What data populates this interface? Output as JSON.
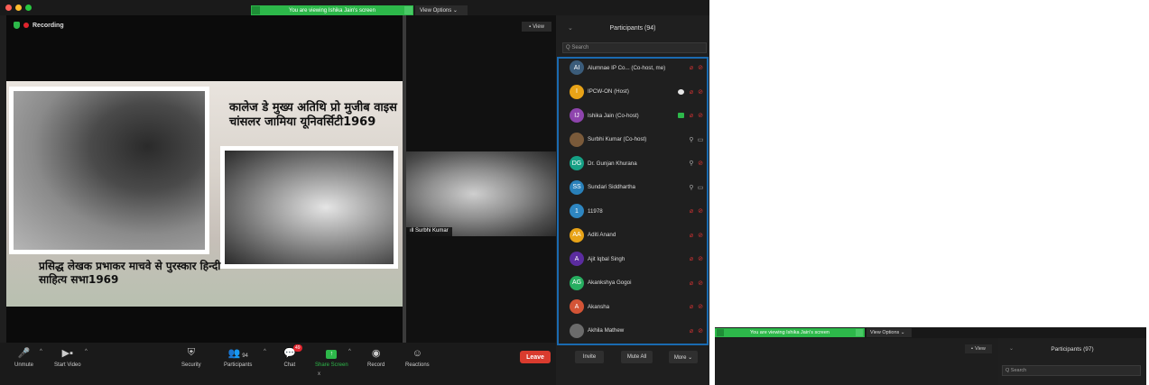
{
  "window": {
    "viewing_banner": "You are viewing Ishika Jain's screen",
    "view_options": "View Options ⌄",
    "recording": "Recording",
    "view_button": "View",
    "bottom_x": "x"
  },
  "slide": {
    "caption_top": "कालेज डे मुख्य अतिथि प्रो मुजीब वाइस चांसलर जामिया यूनिवर्सिटी1969",
    "caption_bottom": "प्रसिद्ध लेखक प्रभाकर माचवे से पुरस्कार हिन्दी साहित्य सभा1969"
  },
  "video": {
    "name": "Surbhi Kumar"
  },
  "participants_panel": {
    "title": "Participants (94)",
    "search_placeholder": "Q Search",
    "items": [
      {
        "initials": "AI",
        "name": "Alumnae IP Co... (Co-host, me)",
        "color": "#3b5c7a",
        "mic": "muted",
        "cam": "off"
      },
      {
        "initials": "I",
        "name": "IPCW-ON (Host)",
        "color": "#e8a317",
        "mic": "muted",
        "cam": "off",
        "extra": "white"
      },
      {
        "initials": "IJ",
        "name": "Ishika Jain (Co-host)",
        "color": "#8e44ad",
        "mic": "muted",
        "cam": "off",
        "extra": "green"
      },
      {
        "initials": "",
        "name": "Surbhi Kumar (Co-host)",
        "color": "#7a5a3a",
        "mic": "on",
        "cam": "on"
      },
      {
        "initials": "DG",
        "name": "Dr. Gunjan Khurana",
        "color": "#16a085",
        "mic": "on",
        "cam": "off"
      },
      {
        "initials": "SS",
        "name": "Sundari Siddhartha",
        "color": "#2980b9",
        "mic": "on",
        "cam": "on"
      },
      {
        "initials": "1",
        "name": "11978",
        "color": "#2e86c1",
        "mic": "muted",
        "cam": "off"
      },
      {
        "initials": "AA",
        "name": "Aditi Anand",
        "color": "#e8a317",
        "mic": "muted",
        "cam": "off"
      },
      {
        "initials": "A",
        "name": "Ajit Iqbal Singh",
        "color": "#5b2c9f",
        "mic": "muted",
        "cam": "off"
      },
      {
        "initials": "AG",
        "name": "Akankshya Gogoi",
        "color": "#27ae60",
        "mic": "muted",
        "cam": "off"
      },
      {
        "initials": "A",
        "name": "Akansha",
        "color": "#d35436",
        "mic": "muted",
        "cam": "off"
      },
      {
        "initials": "",
        "name": "Akhila Mathew",
        "color": "#6b6b6b",
        "mic": "muted",
        "cam": "off"
      }
    ],
    "invite": "Invite",
    "mute_all": "Mute All",
    "more": "More ⌄"
  },
  "toolbar": {
    "unmute": "Unmute",
    "start_video": "Start Video",
    "security": "Security",
    "participants": "Participants",
    "participants_count": "94",
    "chat": "Chat",
    "chat_badge": "49",
    "share_screen": "Share Screen",
    "record": "Record",
    "reactions": "Reactions",
    "leave": "Leave"
  },
  "second_window": {
    "viewing_banner": "You are viewing Ishika Jain's screen",
    "view_options": "View Options ⌄",
    "view_button": "View",
    "participants_title": "Participants (97)",
    "search_placeholder": "Q Search"
  },
  "colors": {
    "accent_green": "#2db84a",
    "leave_red": "#d93b2e",
    "panel_bg": "#1f1f1f",
    "focus_blue": "#1a6ab0"
  }
}
